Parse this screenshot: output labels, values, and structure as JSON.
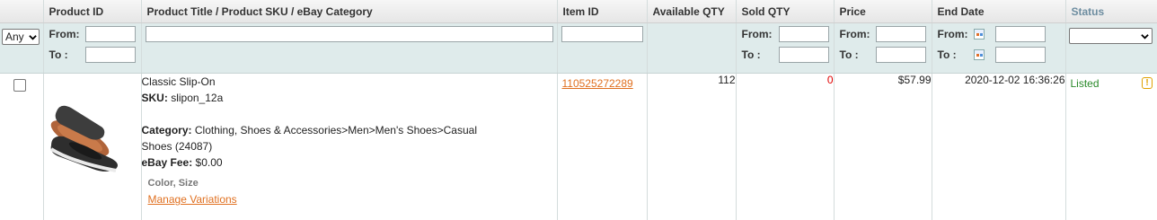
{
  "columns": {
    "product_id": "Product ID",
    "title": "Product Title / Product SKU / eBay Category",
    "item_id": "Item ID",
    "available_qty": "Available QTY",
    "sold_qty": "Sold QTY",
    "price": "Price",
    "end_date": "End Date",
    "status": "Status"
  },
  "filters": {
    "any_select": "Any",
    "from_label": "From:",
    "to_label": "To :",
    "status_select": ""
  },
  "rows": [
    {
      "title": "Classic Slip-On",
      "sku_label": "SKU:",
      "sku": "slipon_12a",
      "category_label": "Category:",
      "category_line1": "Clothing, Shoes & Accessories>Men>Men's Shoes>Casual",
      "category_line2": "Shoes (24087)",
      "fee_label": "eBay Fee:",
      "fee": "$0.00",
      "variations": "Color, Size",
      "manage_variations": "Manage Variations",
      "item_id": "110525272289",
      "available_qty": "112",
      "sold_qty": "0",
      "price": "$57.99",
      "end_date": "2020-12-02 16:36:26",
      "status": "Listed",
      "warning_glyph": "!"
    }
  ],
  "colors": {
    "link": "#e07020",
    "sold_zero": "#e00000",
    "status_listed": "#2a8a2a",
    "filter_bg": "#dfebeb"
  }
}
